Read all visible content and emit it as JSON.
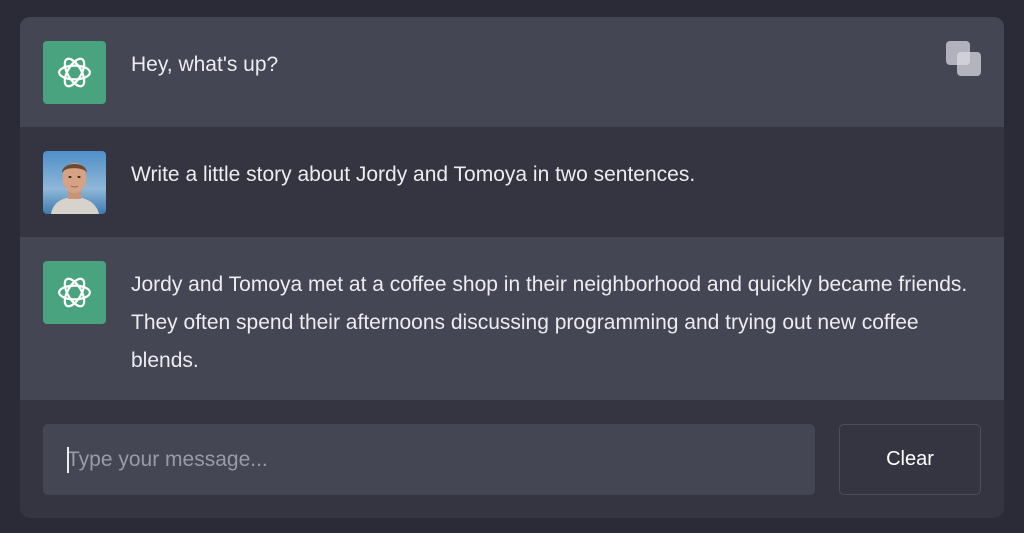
{
  "messages": [
    {
      "role": "assistant",
      "avatar_icon": "openai-logo-icon",
      "text": "Hey, what's up?"
    },
    {
      "role": "user",
      "avatar_icon": "user-photo-avatar",
      "text": "Write a little story about Jordy and Tomoya in two sentences."
    },
    {
      "role": "assistant",
      "avatar_icon": "openai-logo-icon",
      "text": "Jordy and Tomoya met at a coffee shop in their neighborhood and quickly became friends. They often spend their afternoons discussing programming and trying out new coffee blends."
    }
  ],
  "copy_icon": "copy-icon",
  "composer": {
    "value": "",
    "placeholder": "Type your message...",
    "clear_label": "Clear"
  },
  "colors": {
    "page_bg": "#2a2b36",
    "panel_bg": "#343541",
    "assistant_row_bg": "#444654",
    "bot_avatar_bg": "#4aa37f",
    "text": "#ececf1"
  }
}
